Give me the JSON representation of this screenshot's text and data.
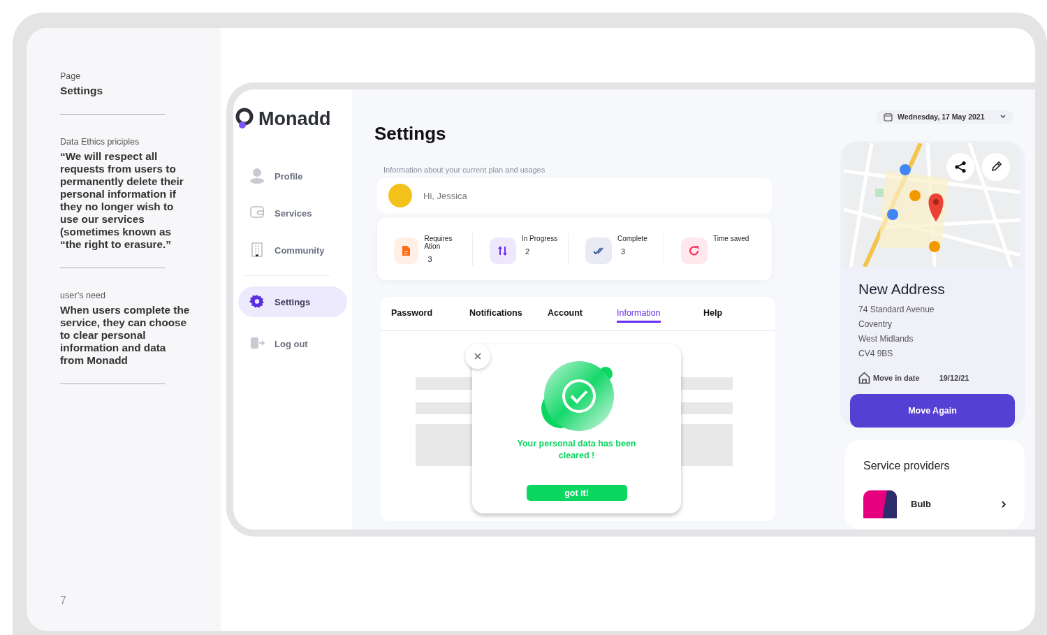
{
  "notes": {
    "sections": [
      {
        "label": "Page",
        "text": "Settings",
        "kind": "title"
      },
      {
        "label": "Data Ethics priciples",
        "text": "“We will respect all requests from users to permanently delete their personal information if they no longer wish to use our services (sometimes known as “the right to erasure.”",
        "kind": "body"
      },
      {
        "label": "user’s need",
        "text": "When users complete the service, they can choose to clear personal information and data from Monadd",
        "kind": "body"
      }
    ],
    "page_number": "7"
  },
  "app": {
    "logo": "Monadd",
    "nav": [
      {
        "label": "Profile",
        "selected": false
      },
      {
        "label": "Services",
        "selected": false
      },
      {
        "label": "Community",
        "selected": false
      },
      {
        "label": "Settings",
        "selected": true
      },
      {
        "label": "Log out",
        "selected": false
      }
    ],
    "title": "Settings",
    "subtitle": "Information about your current plan and usages",
    "greeting": "Hi, Jessica",
    "stats": [
      {
        "label": "Requires Ation",
        "value": "3",
        "color": "#ff6a13"
      },
      {
        "label": "In Progress",
        "value": "2",
        "color": "#6a2cf0"
      },
      {
        "label": "Complete",
        "value": "3",
        "color": "#2b4a9e"
      },
      {
        "label": "Time saved",
        "color": "#ff2a5f"
      }
    ],
    "tabs": [
      {
        "label": "Password",
        "selected": false
      },
      {
        "label": "Notifications",
        "selected": false
      },
      {
        "label": "Account",
        "selected": false
      },
      {
        "label": "Information",
        "selected": true
      },
      {
        "label": "Help",
        "selected": false
      }
    ],
    "dialog": {
      "message": "Your personal data has been cleared !",
      "button": "got it!"
    },
    "date": "Wednesday, 17 May 2021",
    "address": {
      "title": "New Address",
      "lines": [
        "74 Standard Avenue",
        "Coventry",
        "West Midlands",
        "CV4 9BS"
      ],
      "move_label": "Move in date",
      "move_date": "19/12/21",
      "button": "Move Again"
    },
    "providers": {
      "title": "Service providers",
      "items": [
        {
          "name": "Bulb"
        }
      ]
    }
  }
}
